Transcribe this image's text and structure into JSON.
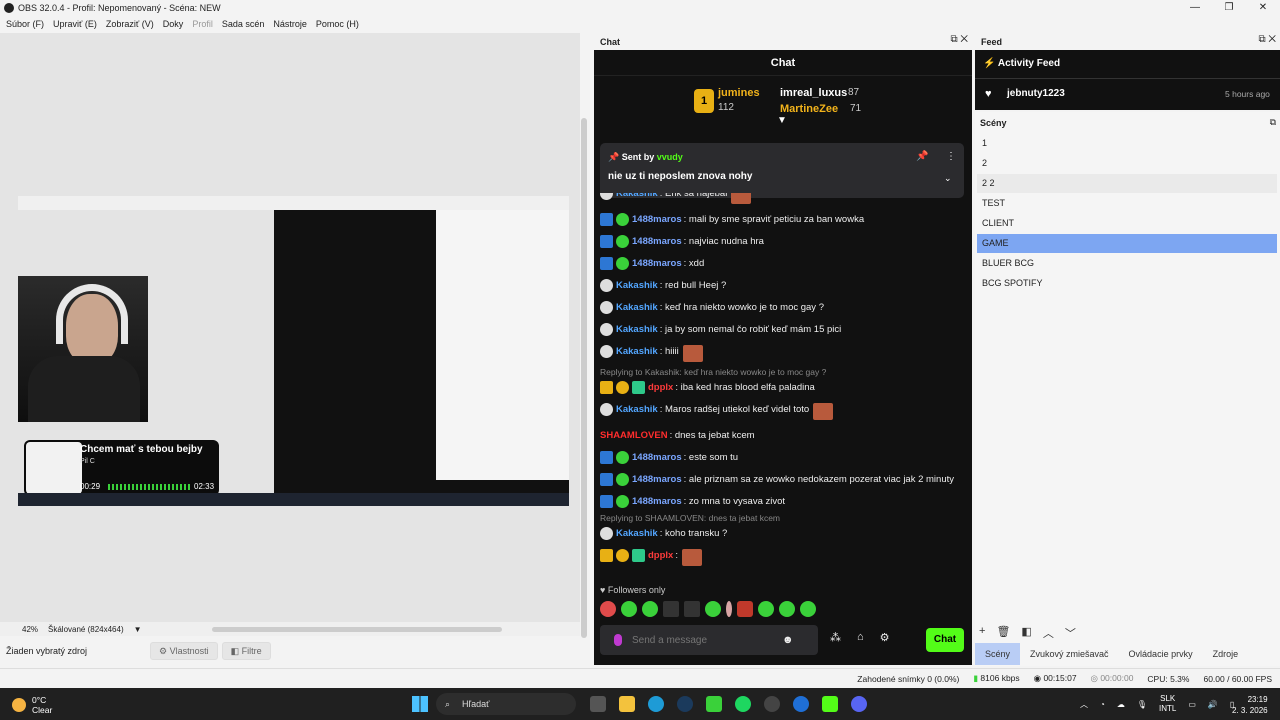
{
  "window": {
    "title": "OBS 32.0.4 - Profil: Nepomenovaný - Scéna: NEW"
  },
  "menu": [
    "Súbor (F)",
    "Upraviť (E)",
    "Zobraziť (V)",
    "Doky",
    "Profil",
    "Sada scén",
    "Nástroje",
    "Pomoc (H)"
  ],
  "preview": {
    "zoom": "42%",
    "scale_label": "Škálované (824x464)",
    "music": {
      "title": "Chcem mať s tebou bejby",
      "artist": "Pil C",
      "elapsed": "00:29",
      "total": "02:33"
    }
  },
  "sourcebar": {
    "no_source": "Žiaden vybratý zdroj",
    "properties": "Vlastnosti",
    "filters": "Filtre"
  },
  "chat": {
    "dock_title": "Chat",
    "header": "Chat",
    "leaders": [
      {
        "name": "jumines",
        "count": "112",
        "rank": "1"
      },
      {
        "name": "imreal_luxus",
        "count": "87"
      },
      {
        "name": "MartineZee",
        "count": "71"
      }
    ],
    "pinned": {
      "sent_by": "Sent by",
      "user": "vvudy",
      "text": "nie uz ti neposlem znova nohy"
    },
    "messages": [
      {
        "user": "Kakashik",
        "text": ": Erik sa najebal",
        "color": "#53a6ff"
      },
      {
        "user": "1488maros",
        "text": ": mali by sme spraviť peticiu za ban wowka",
        "color": "#7aa6ff"
      },
      {
        "user": "1488maros",
        "text": ": najviac nudna hra",
        "color": "#7aa6ff"
      },
      {
        "user": "1488maros",
        "text": ": xdd",
        "color": "#7aa6ff"
      },
      {
        "user": "Kakashik",
        "text": ": red bull Heej ?",
        "color": "#53a6ff"
      },
      {
        "user": "Kakashik",
        "text": ": keď hra niekto wowko je to moc gay ?",
        "color": "#53a6ff"
      },
      {
        "user": "Kakashik",
        "text": ": ja by som nemal čo robiť keď mám 15 pici",
        "color": "#53a6ff"
      },
      {
        "user": "Kakashik",
        "text": ": hiiii",
        "color": "#53a6ff"
      },
      {
        "reply": "Replying to Kakashik: keď hra niekto wowko je to moc gay ?",
        "user": "dpplx",
        "text": ": iba ked hras blood elfa paladina",
        "color": "#ff3b3b"
      },
      {
        "user": "Kakashik",
        "text": ": Maros radšej utiekol keď videl toto",
        "color": "#53a6ff"
      },
      {
        "user": "SHAAMLOVEN",
        "text": ": dnes ta jebat kcem",
        "color": "#ff2d2d"
      },
      {
        "user": "1488maros",
        "text": ": este som tu",
        "color": "#7aa6ff"
      },
      {
        "user": "1488maros",
        "text": ": ale priznam sa ze wowko nedokazem pozerat viac jak 2 minuty",
        "color": "#7aa6ff"
      },
      {
        "user": "1488maros",
        "text": ": zo mna to vysava zivot",
        "color": "#7aa6ff"
      },
      {
        "reply": "Replying to SHAAMLOVEN: dnes ta jebat kcem",
        "user": "Kakashik",
        "text": ": koho transku ?",
        "color": "#53a6ff"
      },
      {
        "user": "dpplx",
        "text": ":",
        "color": "#ff3b3b"
      }
    ],
    "followers_only": "Followers only",
    "input_placeholder": "Send a message",
    "send_label": "Chat"
  },
  "feed": {
    "dock_title": "Feed",
    "header": "Activity Feed",
    "item": {
      "user": "jebnuty1223",
      "time": "5 hours ago"
    }
  },
  "scenes": {
    "title": "Scény",
    "items": [
      "1",
      "2",
      "2 2",
      "TEST",
      "CLIENT",
      "GAME",
      "BLUER BCG",
      "BCG SPOTIFY"
    ],
    "selected": "GAME",
    "tabs": [
      "Scény",
      "Zvukový zmiešavač",
      "Ovládacie prvky",
      "Zdroje"
    ]
  },
  "status": {
    "dropped": "Zahodené snímky 0 (0.0%)",
    "bitrate": "8106 kbps",
    "stream_time": "00:15:07",
    "rec_time": "00:00:00",
    "cpu": "CPU: 5.3%",
    "fps": "60.00 / 60.00 FPS"
  },
  "taskbar": {
    "temp": "0°C",
    "weather": "Clear",
    "search": "Hľadať",
    "lang": "SLK",
    "lang2": "INTL",
    "time": "23:19",
    "date": "2. 3. 2026"
  }
}
